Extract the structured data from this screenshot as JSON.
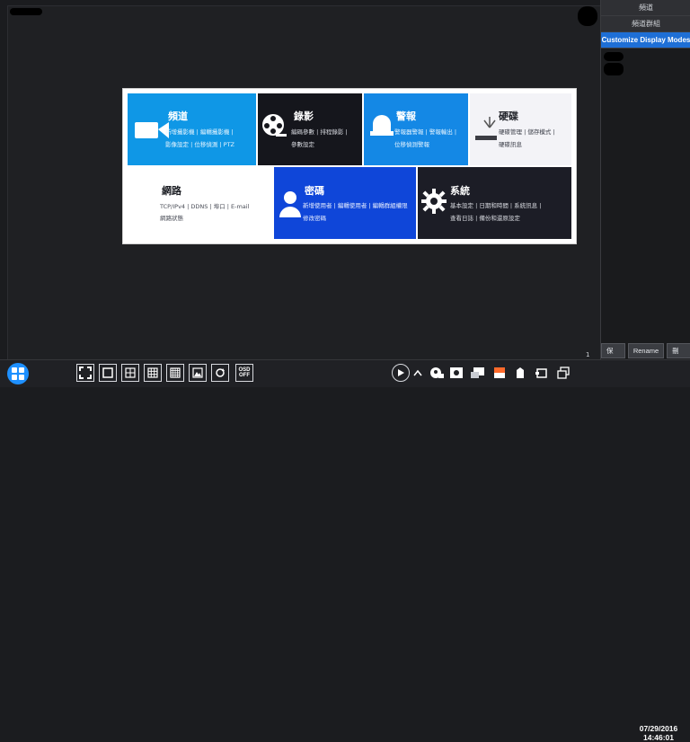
{
  "right_panel": {
    "items": [
      {
        "label": "頻道"
      },
      {
        "label": "頻道群組"
      },
      {
        "label": "Customize Display Modes"
      }
    ],
    "buttons": {
      "save": "保存",
      "rename": "Rename",
      "delete": "刪除"
    }
  },
  "menu": {
    "channel": {
      "title": "頻道",
      "line1": "新增攝影機 | 編輯攝影機 |",
      "line2": "影像設定 | 位移偵測 | PTZ"
    },
    "record": {
      "title": "錄影",
      "line1": "編碼參數 | 排程錄影 |",
      "line2": "參數設定"
    },
    "alarm": {
      "title": "警報",
      "line1": "警報器警報 | 警報輸出 |",
      "line2": "位移偵測警報"
    },
    "disk": {
      "title": "硬碟",
      "line1": "硬碟管理 | 儲存模式 |",
      "line2": "硬碟訊息"
    },
    "network": {
      "title": "網路",
      "line1": "TCP/IPv4 | DDNS | 埠口 | E-mail",
      "line2": "網路狀態"
    },
    "password": {
      "title": "密碼",
      "line1": "新增使用者 | 編輯使用者 | 編輯群組權限",
      "line2": "修改密碼"
    },
    "system": {
      "title": "系統",
      "line1": "基本設定 | 日期和時間 | 系統訊息 |",
      "line2": "查看日誌 | 備份和還原設定"
    }
  },
  "taskbar": {
    "osd_top": "OSD",
    "osd_bottom": "OFF",
    "page_number": "1",
    "date": "07/29/2016",
    "time": "14:46:01"
  },
  "colors": {
    "accent": "#1e6fd6",
    "channel_tile": "#0f97e6",
    "alarm_tile": "#1488e5",
    "password_tile": "#0f46d9",
    "dark_tile": "#15161c"
  }
}
